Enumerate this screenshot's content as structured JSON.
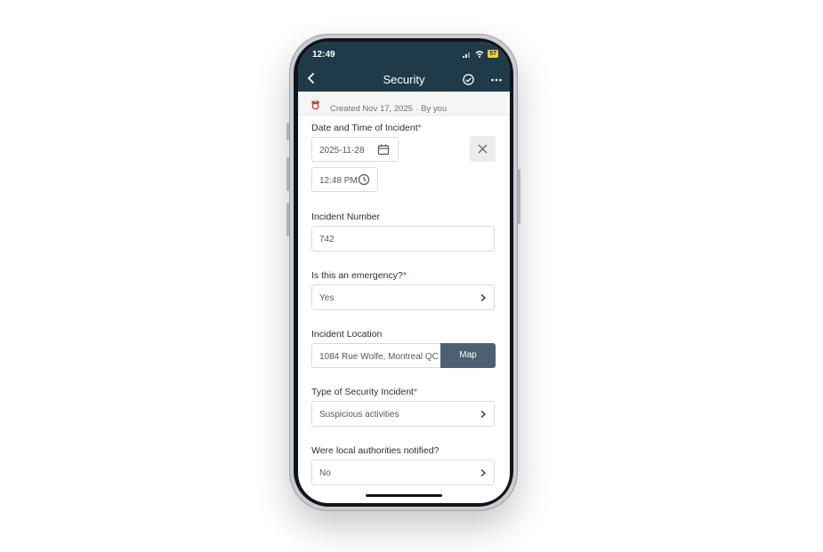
{
  "status_bar": {
    "time": "12:49",
    "battery": "57"
  },
  "header": {
    "title": "Security"
  },
  "meta": {
    "created": "Created Nov 17, 2025",
    "by": "By you"
  },
  "fields": {
    "datetime": {
      "label": "Date and Time of Incident",
      "required_mark": "*",
      "date": "2025-11-28",
      "time": "12:48 PM"
    },
    "incident_number": {
      "label": "Incident Number",
      "value": "742"
    },
    "emergency": {
      "label": "Is this an emergency?",
      "required_mark": "*",
      "value": "Yes"
    },
    "location": {
      "label": "Incident Location",
      "value": "1084 Rue Wolfe, Montreal QC",
      "map_button": "Map"
    },
    "incident_type": {
      "label": "Type of Security Incident",
      "required_mark": "*",
      "value": "Suspicious activities"
    },
    "authorities": {
      "label": "Were local authorities notified?",
      "value": "No"
    }
  },
  "icons": [
    "back-icon",
    "check-circle-icon",
    "more-icon",
    "security-guard-icon",
    "calendar-icon",
    "clock-icon",
    "close-icon",
    "chevron-right-icon"
  ],
  "colors": {
    "header_bg": "#1f3a49",
    "map_button_bg": "#4d6073",
    "required": "#c0392b"
  }
}
